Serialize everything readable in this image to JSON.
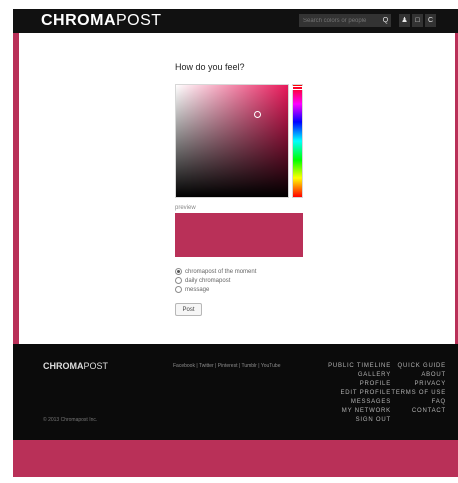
{
  "header": {
    "logo_bold": "CHROMA",
    "logo_light": "POST",
    "search_placeholder": "Search colors or people",
    "search_icon": "Q",
    "icons": [
      "user-icon",
      "square-icon",
      "chromapost-c-icon"
    ],
    "icon_glyphs": [
      "♟",
      "□",
      "C"
    ]
  },
  "main": {
    "title": "How do you feel?",
    "picker": {
      "selected_color": "#b93058",
      "base_hue_color": "#e8195a"
    },
    "preview_label": "preview",
    "options": [
      {
        "label": "chromapost of the moment",
        "selected": true
      },
      {
        "label": "daily chromapost",
        "selected": false
      },
      {
        "label": "message",
        "selected": false
      }
    ],
    "post_button": "Post"
  },
  "footer": {
    "logo_bold": "CHROMA",
    "logo_light": "POST",
    "social_links": "Facebook | Twitter | Pinterest | Tumblr | YouTube",
    "col1": [
      "PUBLIC TIMELINE",
      "GALLERY",
      "PROFILE",
      "EDIT PROFILE",
      "MESSAGES",
      "MY NETWORK",
      "SIGN OUT"
    ],
    "col2": [
      "QUICK GUIDE",
      "ABOUT",
      "PRIVACY",
      "TERMS OF USE",
      "FAQ",
      "CONTACT"
    ],
    "copyright": "© 2013 Chromapost Inc."
  },
  "colors": {
    "accent": "#b93058",
    "header_bg": "#111111",
    "footer_bg": "#0b0b0b"
  }
}
